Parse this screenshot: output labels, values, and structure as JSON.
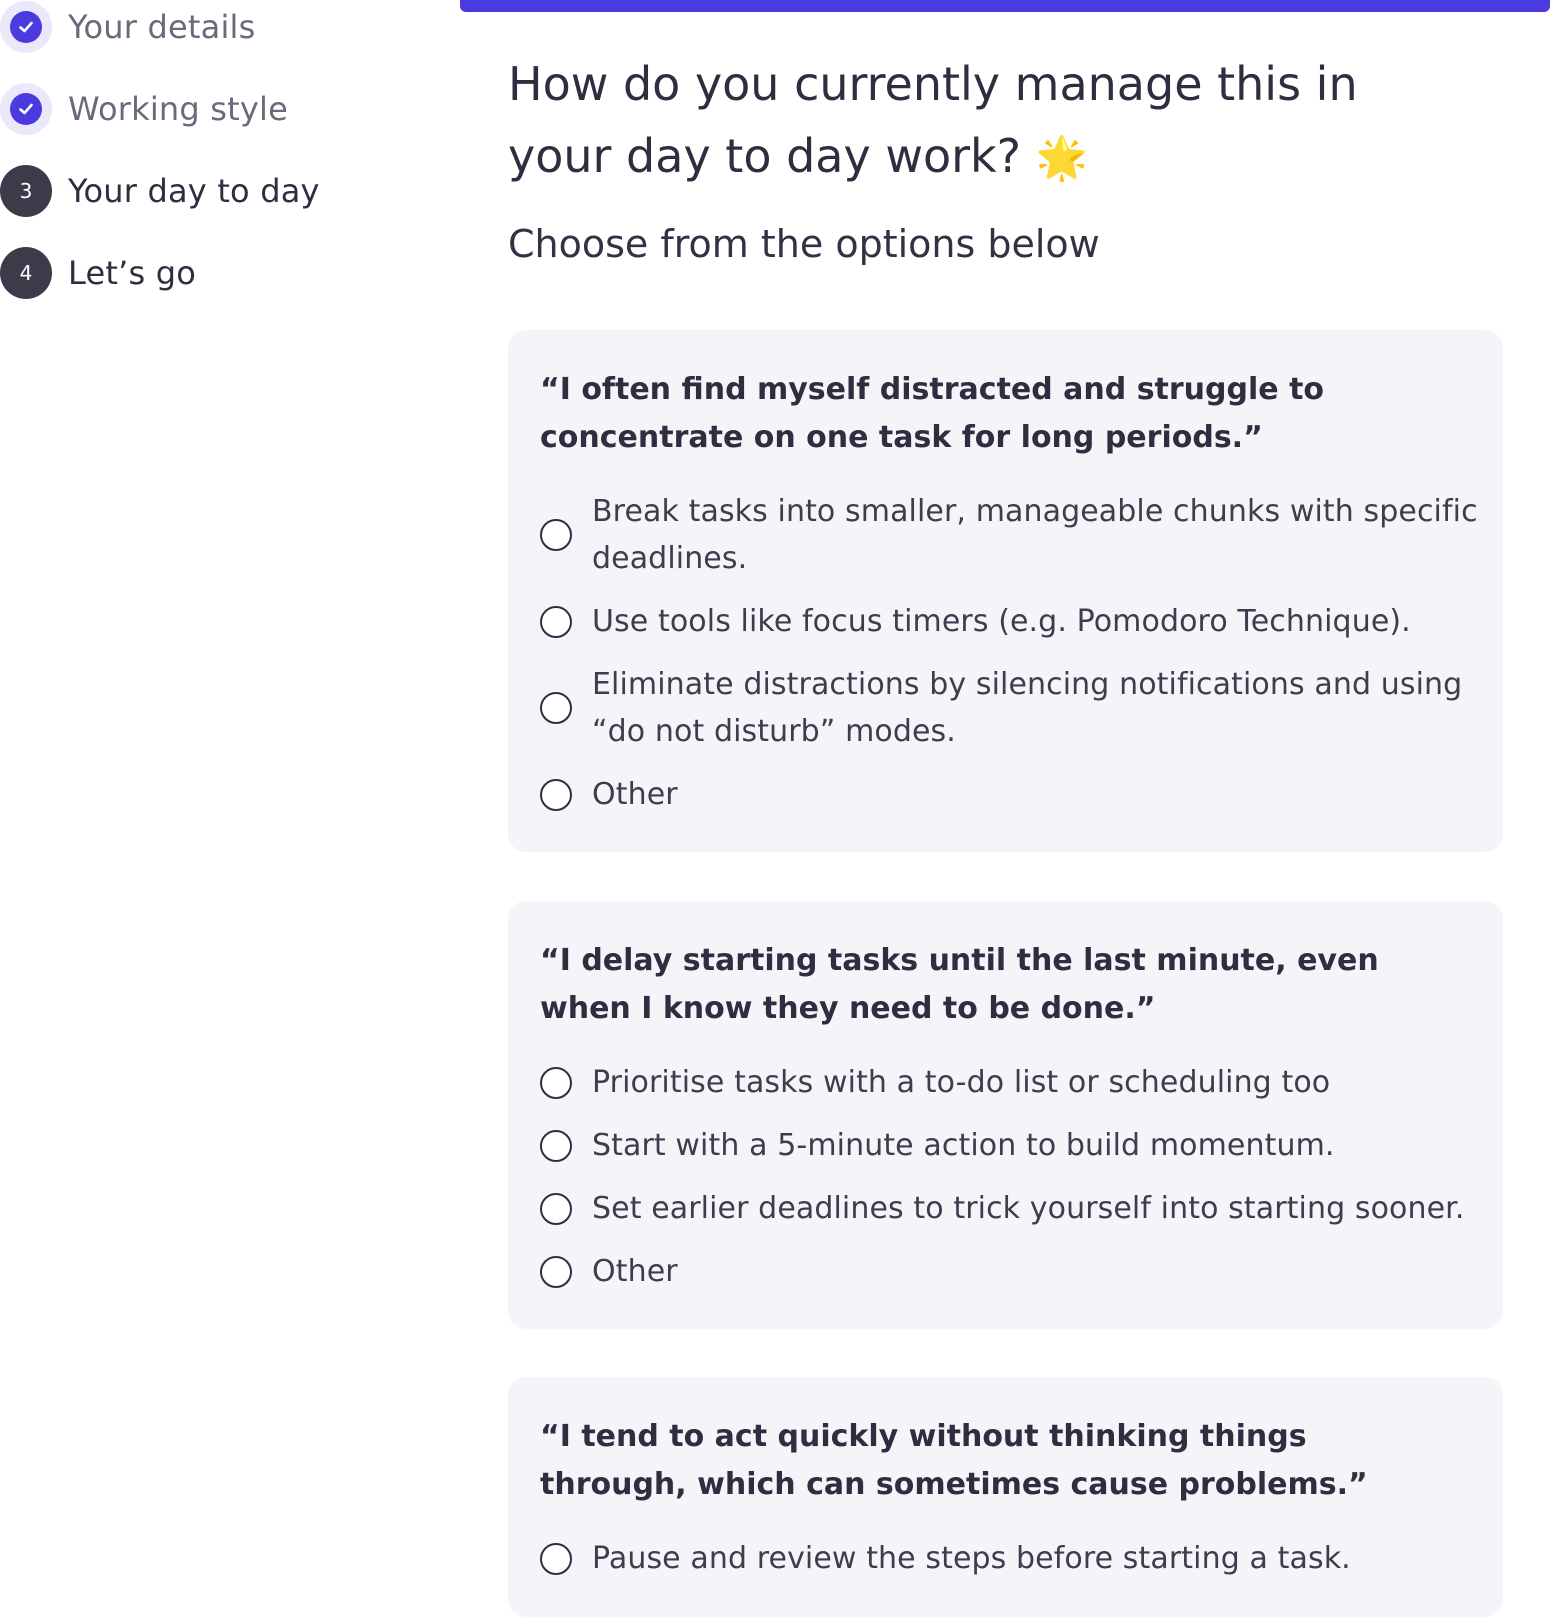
{
  "steps": [
    {
      "label": "Your details",
      "status": "done",
      "number": ""
    },
    {
      "label": "Working style",
      "status": "done",
      "number": ""
    },
    {
      "label": "Your day to day",
      "status": "current",
      "number": "3"
    },
    {
      "label": "Let’s go",
      "status": "upcoming",
      "number": "4"
    }
  ],
  "main": {
    "title": "How do you currently manage this in your day to day work?",
    "title_emoji": "🌟",
    "subtitle": "Choose from the options below",
    "accent_color": "#4a3ae0"
  },
  "questions": [
    {
      "statement": "“I often find myself distracted and struggle to concentrate on one task for long periods.”",
      "options": [
        "Break tasks into smaller, manageable chunks with specific deadlines.",
        "Use tools like focus timers (e.g. Pomodoro Technique).",
        "Eliminate distractions by silencing notifications and using “do not disturb” modes.",
        "Other"
      ]
    },
    {
      "statement": "“I delay starting tasks until the last minute, even when I know they need to be done.”",
      "options": [
        "Prioritise tasks with a to-do list or scheduling too",
        "Start with a 5-minute action to build momentum.",
        "Set earlier deadlines to trick yourself into starting sooner.",
        "Other"
      ]
    },
    {
      "statement": "“I tend to act quickly without thinking things through, which can sometimes cause problems.”",
      "options": [
        "Pause and review the steps before starting a task."
      ]
    }
  ]
}
